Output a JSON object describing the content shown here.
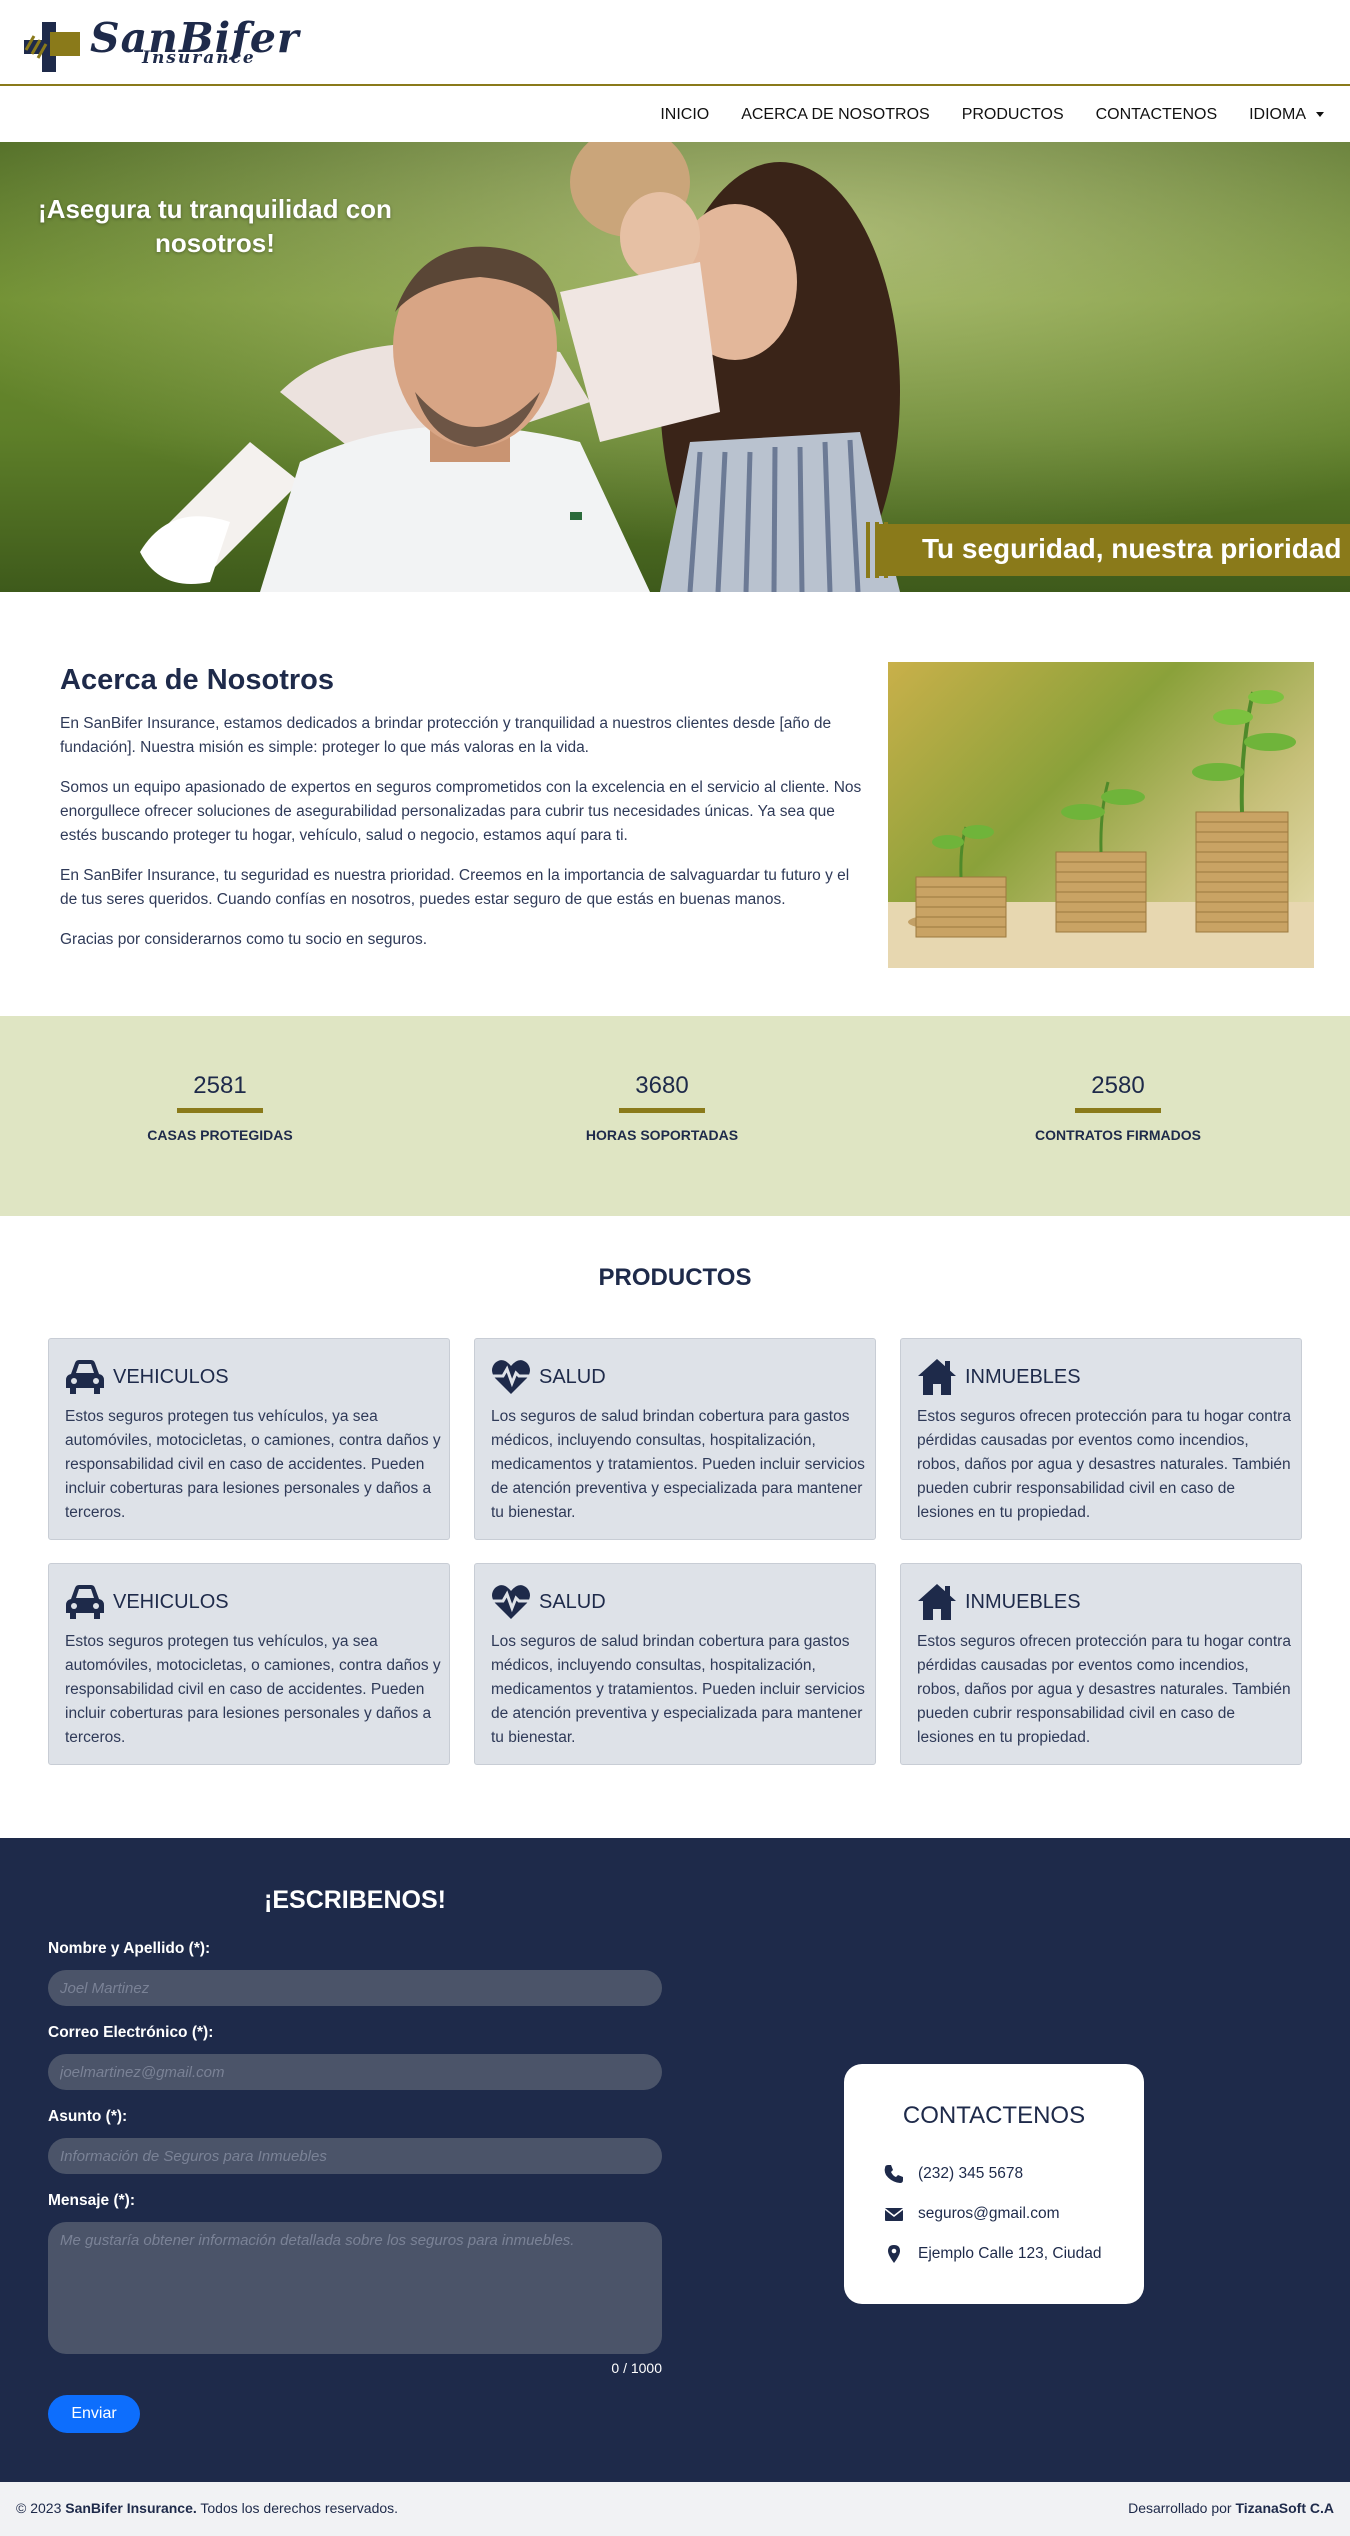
{
  "brand": {
    "name": "SanBifer",
    "subtitle": "Insurance",
    "accent_color": "#8a7a1a",
    "navy_color": "#1e2a4a"
  },
  "nav": {
    "items": [
      "INICIO",
      "ACERCA DE NOSOTROS",
      "PRODUCTOS",
      "CONTACTENOS",
      "IDIOMA"
    ]
  },
  "hero": {
    "tagline": "¡Asegura tu tranquilidad con nosotros!",
    "banner": "Tu seguridad, nuestra prioridad"
  },
  "about": {
    "title": "Acerca de Nosotros",
    "paragraphs": [
      "En SanBifer Insurance, estamos dedicados a brindar protección y tranquilidad a nuestros clientes desde [año de fundación]. Nuestra misión es simple: proteger lo que más valoras en la vida.",
      "Somos un equipo apasionado de expertos en seguros comprometidos con la excelencia en el servicio al cliente. Nos enorgullece ofrecer soluciones de asegurabilidad personalizadas para cubrir tus necesidades únicas. Ya sea que estés buscando proteger tu hogar, vehículo, salud o negocio, estamos aquí para ti.",
      "En SanBifer Insurance, tu seguridad es nuestra prioridad. Creemos en la importancia de salvaguardar tu futuro y el de tus seres queridos. Cuando confías en nosotros, puedes estar seguro de que estás en buenas manos.",
      "Gracias por considerarnos como tu socio en seguros."
    ]
  },
  "stats": [
    {
      "value": "2581",
      "label": "CASAS PROTEGIDAS"
    },
    {
      "value": "3680",
      "label": "HORAS SOPORTADAS"
    },
    {
      "value": "2580",
      "label": "CONTRATOS FIRMADOS"
    }
  ],
  "products": {
    "title": "PRODUCTOS",
    "cards": [
      {
        "icon": "car-icon",
        "title": "VEHICULOS",
        "text": "Estos seguros protegen tus vehículos, ya sea automóviles, motocicletas, o camiones, contra daños y responsabilidad civil en caso de accidentes. Pueden incluir coberturas para lesiones personales y daños a terceros."
      },
      {
        "icon": "heartbeat-icon",
        "title": "SALUD",
        "text": "Los seguros de salud brindan cobertura para gastos médicos, incluyendo consultas, hospitalización, medicamentos y tratamientos. Pueden incluir servicios de atención preventiva y especializada para mantener tu bienestar."
      },
      {
        "icon": "house-icon",
        "title": "INMUEBLES",
        "text": "Estos seguros ofrecen protección para tu hogar contra pérdidas causadas por eventos como incendios, robos, daños por agua y desastres naturales. También pueden cubrir responsabilidad civil en caso de lesiones en tu propiedad."
      },
      {
        "icon": "car-icon",
        "title": "VEHICULOS",
        "text": "Estos seguros protegen tus vehículos, ya sea automóviles, motocicletas, o camiones, contra daños y responsabilidad civil en caso de accidentes. Pueden incluir coberturas para lesiones personales y daños a terceros."
      },
      {
        "icon": "heartbeat-icon",
        "title": "SALUD",
        "text": "Los seguros de salud brindan cobertura para gastos médicos, incluyendo consultas, hospitalización, medicamentos y tratamientos. Pueden incluir servicios de atención preventiva y especializada para mantener tu bienestar."
      },
      {
        "icon": "house-icon",
        "title": "INMUEBLES",
        "text": "Estos seguros ofrecen protección para tu hogar contra pérdidas causadas por eventos como incendios, robos, daños por agua y desastres naturales. También pueden cubrir responsabilidad civil en caso de lesiones en tu propiedad."
      }
    ]
  },
  "form": {
    "title": "¡ESCRIBENOS!",
    "name_label": "Nombre y Apellido (*):",
    "name_placeholder": "Joel Martinez",
    "email_label": "Correo Electrónico (*):",
    "email_placeholder": "joelmartinez@gmail.com",
    "subject_label": "Asunto (*):",
    "subject_placeholder": "Información de Seguros para Inmuebles",
    "message_label": "Mensaje (*):",
    "message_placeholder": "Me gustaría obtener información detallada sobre los seguros para inmuebles.",
    "counter": "0 / 1000",
    "submit_label": "Enviar"
  },
  "contact_card": {
    "title": "CONTACTENOS",
    "phone": "(232) 345 5678",
    "email": "seguros@gmail.com",
    "address": "Ejemplo Calle 123, Ciudad"
  },
  "footer": {
    "copyright_prefix": "© 2023",
    "company": "SanBifer Insurance.",
    "rights": "Todos los derechos reservados.",
    "dev_prefix": "Desarrollado por",
    "developer": "TizanaSoft C.A"
  }
}
